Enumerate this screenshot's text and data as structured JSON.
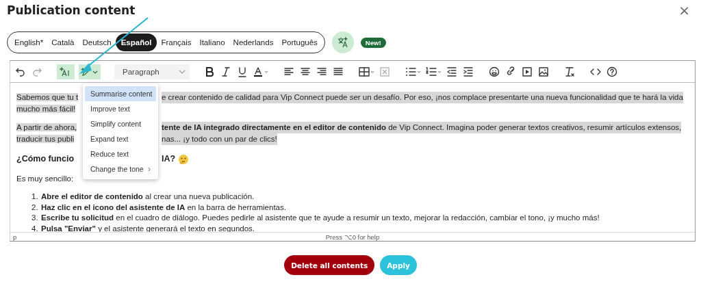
{
  "dialog": {
    "title": "Publication content",
    "close": "×"
  },
  "languages": [
    {
      "label": "English*",
      "selected": false
    },
    {
      "label": "Català",
      "selected": false
    },
    {
      "label": "Deutsch",
      "selected": false
    },
    {
      "label": "Español",
      "selected": true
    },
    {
      "label": "Français",
      "selected": false
    },
    {
      "label": "Italiano",
      "selected": false
    },
    {
      "label": "Nederlands",
      "selected": false
    },
    {
      "label": "Português",
      "selected": false
    }
  ],
  "new_badge": "New!",
  "toolbar": {
    "history": [
      {
        "kind": "undo",
        "disabled": false
      },
      {
        "kind": "redo",
        "disabled": true
      }
    ],
    "ai_buttons": [
      {
        "kind": "ai-text",
        "active": true
      },
      {
        "kind": "ai-pencil",
        "active": true
      }
    ],
    "block_format": "Paragraph"
  },
  "ai_menu": [
    {
      "label": "Summarise content",
      "selected": true,
      "submenu": false
    },
    {
      "label": "Improve text",
      "selected": false,
      "submenu": false
    },
    {
      "label": "Simplify content",
      "selected": false,
      "submenu": false
    },
    {
      "label": "Expand text",
      "selected": false,
      "submenu": false
    },
    {
      "label": "Reduce text",
      "selected": false,
      "submenu": false
    },
    {
      "label": "Change the tone",
      "selected": false,
      "submenu": true
    }
  ],
  "content": [
    {
      "kind": "paragraph",
      "highlighted": true,
      "lines": [
        {
          "left": "Sabemos que tu t",
          "right": "e crear contenido de calidad para Vip Connect puede ser un desafío. Por eso, ¡nos complace presentarte una nueva funcionalidad que te hará la vida"
        },
        {
          "left": "mucho más fácil!"
        }
      ]
    },
    {
      "kind": "paragraph",
      "highlighted": true,
      "lines": [
        {
          "left": "A partir de ahora,",
          "right": "**tente de IA integrado directamente en el editor de contenido** de Vip Connect. Imagina poder generar textos creativos, resumir artículos extensos,"
        },
        {
          "left": "traducir tus publi",
          "right": "nas... ¡y todo con un par de clics!"
        }
      ]
    },
    {
      "kind": "heading",
      "highlighted": false,
      "lines": [
        {
          "left": "¿Cómo funcio",
          "right": "IA?",
          "emoji": true
        }
      ]
    },
    {
      "kind": "paragraph",
      "highlighted": false,
      "lines": [
        {
          "left": "Es muy sencillo:"
        }
      ]
    },
    {
      "kind": "list",
      "items": [
        {
          "number": "1.",
          "text": "**Abre el editor de contenido** al crear una nueva publicación."
        },
        {
          "number": "2.",
          "text": "**Haz clic en el icono del asistente de IA** en la barra de herramientas."
        },
        {
          "number": "3.",
          "text": "**Escribe tu solicitud** en el cuadro de diálogo. Puedes pedirle al asistente que te ayude a resumir un texto, mejorar la redacción, cambiar el tono, ¡y mucho más!"
        },
        {
          "number": "4.",
          "text": "**Pulsa \"Enviar\"** y el asistente generará el texto en segundos."
        }
      ]
    }
  ],
  "status_bar": {
    "path": "p",
    "help": "Press ⌥0 for help"
  },
  "buttons": [
    {
      "label": "Delete all contents",
      "kind": "danger"
    },
    {
      "label": "Apply",
      "kind": "primary"
    }
  ]
}
